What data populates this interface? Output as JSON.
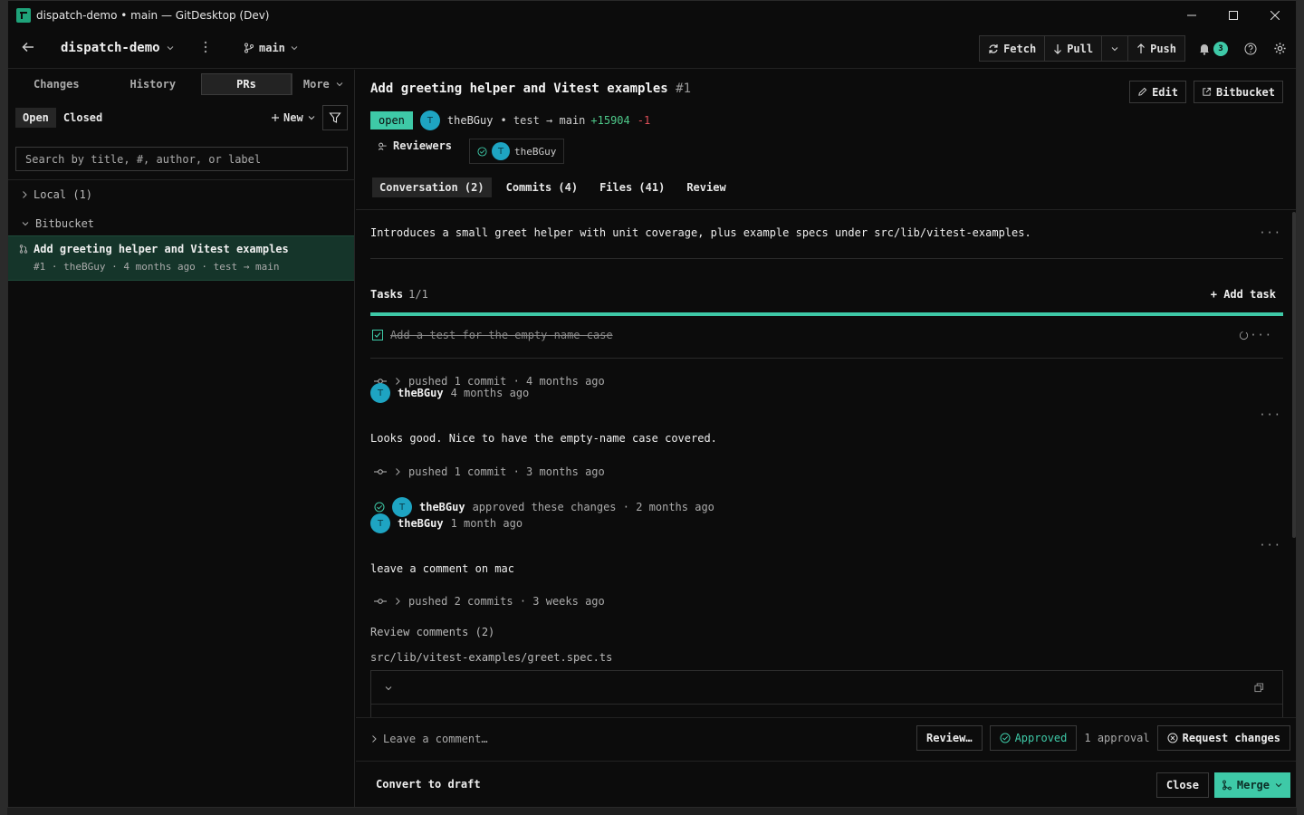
{
  "window": {
    "title": "dispatch-demo • main — GitDesktop (Dev)"
  },
  "toolbar": {
    "repo": "dispatch-demo",
    "branch": "main",
    "fetch": "Fetch",
    "pull": "Pull",
    "push": "Push",
    "notifications": "3"
  },
  "sidebar": {
    "tabs": [
      {
        "label": "Changes"
      },
      {
        "label": "History"
      },
      {
        "label": "PRs"
      },
      {
        "label": "More"
      }
    ],
    "filter_open": "Open",
    "filter_closed": "Closed",
    "new_label": "New",
    "search_placeholder": "Search by title, #, author, or label",
    "groups": {
      "local": "Local (1)",
      "bitbucket": "Bitbucket"
    },
    "pr_item": {
      "title": "Add greeting helper and Vitest examples",
      "meta": "#1 · theBGuy · 4 months ago · test → main"
    }
  },
  "pr": {
    "title": "Add greeting helper and Vitest examples",
    "number": "#1",
    "edit_label": "Edit",
    "bitbucket_label": "Bitbucket",
    "status": "open",
    "avatar_initial": "T",
    "author": "theBGuy",
    "branches": "• test → main",
    "additions": "+15904",
    "deletions": "-1",
    "reviewers_label": "Reviewers",
    "reviewer": "theBGuy",
    "tabs": {
      "conversation": "Conversation (2)",
      "commits": "Commits (4)",
      "files": "Files (41)",
      "review": "Review"
    },
    "description": "Introduces a small greet helper with unit coverage, plus example specs under src/lib/vitest-examples.",
    "tasks_label": "Tasks",
    "tasks_count": "1/1",
    "add_task": "Add task",
    "task_text": "Add a test for the empty-name case",
    "timeline": {
      "push1": "pushed 1 commit · 4 months ago",
      "c1_author": "theBGuy",
      "c1_time": "4 months ago",
      "c1_body": "Looks good. Nice to have the empty-name case covered.",
      "push2": "pushed 1 commit · 3 months ago",
      "approve_author": "theBGuy",
      "approve_text": "approved these changes · 2 months ago",
      "c2_author": "theBGuy",
      "c2_time": "1 month ago",
      "c2_body": "leave a comment on mac",
      "push3": "pushed 2 commits · 3 weeks ago"
    },
    "review_comments": "Review comments (2)",
    "file_path": "src/lib/vitest-examples/greet.spec.ts",
    "leave_comment": "Leave a comment…",
    "review_btn": "Review…",
    "approved_btn": "Approved",
    "approval_count": "1 approval",
    "request_changes": "Request changes",
    "convert_draft": "Convert to draft",
    "close_btn": "Close",
    "merge_btn": "Merge"
  },
  "colors": {
    "accent": "#3ec9a7",
    "selected_bg": "#15352a",
    "avatar": "#1ea4c2",
    "additions": "#4ec98a",
    "deletions": "#e0505a"
  }
}
